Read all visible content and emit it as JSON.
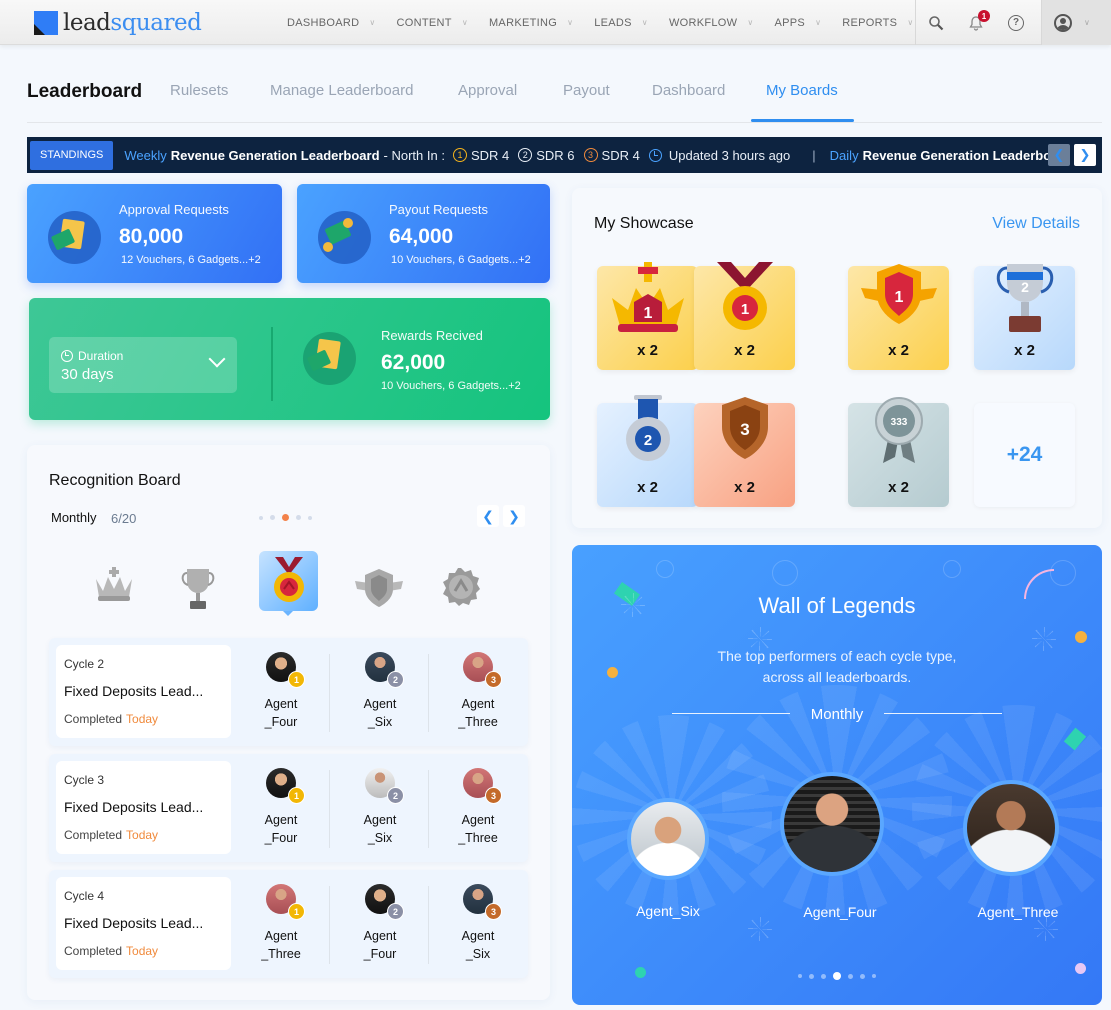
{
  "nav": {
    "logo": {
      "part1": "lead",
      "part2": "squared"
    },
    "menu": [
      {
        "label": "DASHBOARD"
      },
      {
        "label": "CONTENT"
      },
      {
        "label": "MARKETING"
      },
      {
        "label": "LEADS"
      },
      {
        "label": "WORKFLOW"
      },
      {
        "label": "APPS"
      },
      {
        "label": "REPORTS"
      }
    ],
    "icons": {
      "search": "search-icon",
      "notifications": "bell-icon",
      "help": "help-icon",
      "user": "user-icon"
    },
    "notification_count": "1",
    "help_glyph": "?"
  },
  "tabs": {
    "title": "Leaderboard",
    "items": [
      {
        "label": "Rulesets"
      },
      {
        "label": "Manage Leaderboard"
      },
      {
        "label": "Approval"
      },
      {
        "label": "Payout"
      },
      {
        "label": "Dashboard"
      },
      {
        "label": "My Boards"
      }
    ],
    "active": "My Boards"
  },
  "standings": {
    "badge": "STANDINGS",
    "items": [
      {
        "frequency": "Weekly",
        "title": "Revenue Generation Leaderboard",
        "region": "- North In :",
        "ranks": [
          {
            "rank": "1",
            "name": "SDR 4"
          },
          {
            "rank": "2",
            "name": "SDR 6"
          },
          {
            "rank": "3",
            "name": "SDR 4"
          }
        ],
        "updated": "Updated 3 hours ago"
      },
      {
        "frequency": "Daily",
        "title": "Revenue Generation Leaderboar"
      }
    ],
    "separator": "|"
  },
  "stats": {
    "approval": {
      "label": "Approval Requests",
      "value": "80,000",
      "sub": "12 Vouchers, 6 Gadgets...+2"
    },
    "payout": {
      "label": "Payout Requests",
      "value": "64,000",
      "sub": "10 Vouchers, 6 Gadgets...+2"
    },
    "duration": {
      "label": "Duration",
      "value": "30 days"
    },
    "rewards": {
      "label": "Rewards Recived",
      "value": "62,000",
      "sub": "10 Vouchers, 6 Gadgets...+2"
    }
  },
  "recognition": {
    "title": "Recognition Board",
    "period": "Monthly",
    "count": "6/20",
    "badges": [
      "crown",
      "trophy",
      "medal",
      "winged-shield",
      "rosette"
    ],
    "selected_badge": "medal",
    "cycles": [
      {
        "name": "Cycle 2",
        "board": "Fixed Deposits Lead...",
        "status": "Completed",
        "when": "Today",
        "agents": [
          {
            "rank": "1",
            "line1": "Agent",
            "line2": "_Four"
          },
          {
            "rank": "2",
            "line1": "Agent",
            "line2": "_Six"
          },
          {
            "rank": "3",
            "line1": "Agent",
            "line2": "_Three"
          }
        ]
      },
      {
        "name": "Cycle 3",
        "board": "Fixed Deposits Lead...",
        "status": "Completed",
        "when": "Today",
        "agents": [
          {
            "rank": "1",
            "line1": "Agent",
            "line2": "_Four"
          },
          {
            "rank": "2",
            "line1": "Agent",
            "line2": "_Six"
          },
          {
            "rank": "3",
            "line1": "Agent",
            "line2": "_Three"
          }
        ]
      },
      {
        "name": "Cycle 4",
        "board": "Fixed Deposits Lead...",
        "status": "Completed",
        "when": "Today",
        "agents": [
          {
            "rank": "1",
            "line1": "Agent",
            "line2": "_Three"
          },
          {
            "rank": "2",
            "line1": "Agent",
            "line2": "_Four"
          },
          {
            "rank": "3",
            "line1": "Agent",
            "line2": "_Six"
          }
        ]
      }
    ]
  },
  "showcase": {
    "title": "My Showcase",
    "link": "View Details",
    "items": [
      {
        "badge": "gold-crown",
        "rank": "1",
        "count": "x 2"
      },
      {
        "badge": "gold-medal",
        "rank": "1",
        "count": "x 2"
      },
      {
        "badge": "gold-winged-shield",
        "rank": "1",
        "count": "x 2"
      },
      {
        "badge": "silver-trophy",
        "rank": "2",
        "count": "x 2"
      },
      {
        "badge": "silver-medal",
        "rank": "2",
        "count": "x 2"
      },
      {
        "badge": "bronze-shield",
        "rank": "3",
        "count": "x 2"
      },
      {
        "badge": "rosette",
        "rank": "333",
        "count": "x 2"
      }
    ],
    "more": "+24"
  },
  "wall": {
    "title": "Wall of Legends",
    "subtitle_line1": "The top performers of each cycle type,",
    "subtitle_line2": "across all leaderboards.",
    "period": "Monthly",
    "legends": [
      {
        "name": "Agent_Six"
      },
      {
        "name": "Agent_Four"
      },
      {
        "name": "Agent_Three"
      }
    ],
    "page_count": 7,
    "active_page": 4
  }
}
